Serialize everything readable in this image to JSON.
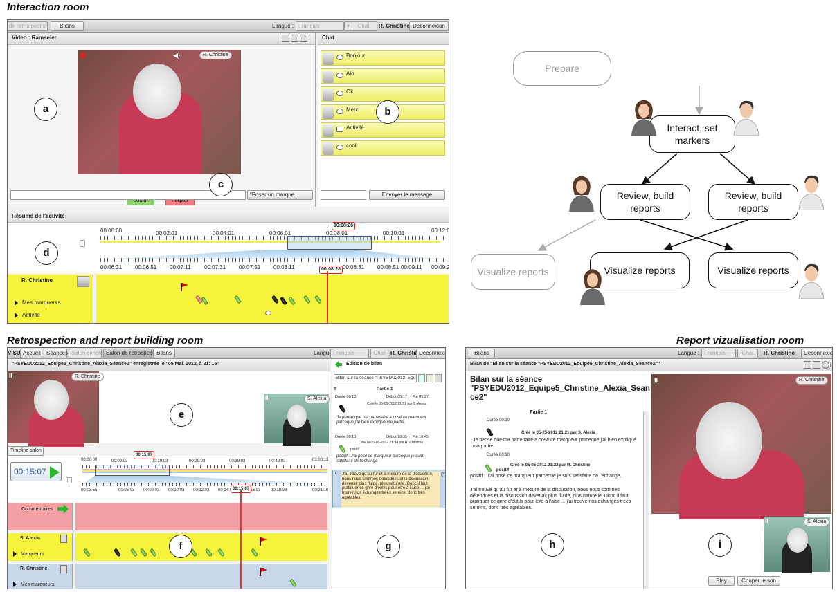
{
  "titles": {
    "interaction": "Interaction room",
    "retrospection": "Retrospection and report building room",
    "report": "Report vizualisation room"
  },
  "labels": {
    "a": "a",
    "b": "b",
    "c": "c",
    "d": "d",
    "e": "e",
    "f": "f",
    "g": "g",
    "h": "h",
    "i": "i"
  },
  "interaction": {
    "tabs": {
      "retro": "de rétrospection",
      "bilans": "Bilans"
    },
    "langue_label": "Langue :",
    "langue_value": "Français",
    "chat_btn": "Chat",
    "user": "R. Christine",
    "logout": "Déconnexion",
    "video_title": "Video : Ramseier",
    "video_badge": "R. Christine",
    "positif": "positif",
    "negatif": "négatif",
    "poser": "\"Poser un marque...",
    "chat_title": "Chat",
    "chat_messages": [
      "Bonjour",
      "Alo",
      "Ok",
      "Merci",
      "Activité",
      "cool"
    ],
    "send": "Envoyer le message",
    "resume": "Résumé de l'activité",
    "top_ticks": [
      "00:00:00",
      "00:02:01",
      "00:04:01",
      "00:06:01",
      "00:08:01",
      "00:10:01",
      "00:12:0"
    ],
    "bottom_ticks": [
      "00:06:31",
      "00:06:51",
      "00:07:11",
      "00:07:31",
      "00:07:51",
      "00:08:11",
      "00:08:31",
      "00:08:51",
      "00:09:11",
      "00:09:2"
    ],
    "time_top": "00:08:28",
    "time_bottom": "00:08:28",
    "lane_user": "R. Christine",
    "lane_mes": "Mes marqueurs",
    "lane_act": "Activité"
  },
  "workflow": {
    "prepare": "Prepare",
    "interact": "Interact, set markers",
    "review1": "Review, build reports",
    "review2": "Review, build reports",
    "vis_grey": "Visualize reports",
    "vis1": "Visualize reports",
    "vis2": "Visualize reports"
  },
  "retro": {
    "tabs": [
      "VISU",
      "Accueil",
      "Séances",
      "Salon synchrone",
      "Salon de rétrospection",
      "Bilans"
    ],
    "langue_label": "Langue",
    "langue_value": "Français",
    "chat_btn": "Chat",
    "user": "R. Christine",
    "logout": "Déconnexion",
    "session": "\"PSYEDU2012_Equipe5_Christine_Alexia_Seance2\" enregistrée le \"05 Mai. 2012, à 21: 15\"",
    "badge_main": "R. Christine",
    "badge_small": "S. Alexia",
    "timeline_tab": "Timeline salon",
    "clock": "00:15:07",
    "top_ticks": [
      "00:00:00",
      "00:09:03",
      "00:19:03",
      "00:29:03",
      "00:39:03",
      "00:49:03",
      "01:00:13"
    ],
    "bottom_ticks": [
      "00:03:55",
      "00:05:03",
      "00:08:03",
      "00:10:03",
      "00:12:03",
      "00:14:03",
      "00:16:03",
      "00:18:03",
      "00:21:10"
    ],
    "time_top": "00:15:07",
    "time_bottom": "00:15:07",
    "lane_comments": "Commentaires",
    "lane_alexia": "S. Alexia",
    "lane_marqueurs": "Marqueurs",
    "lane_christine": "R. Christine",
    "lane_mes": "Mes marqueurs",
    "bilan_title": "Édition de bilan",
    "bilan_select": "Bilan sur la séance \"PSYEDU2012_Equipe5_C",
    "col_t": "T",
    "col_part": "Partie 1",
    "e1_duree": "Durée 00:10",
    "e1_debut": "Début 05:17",
    "e1_fin": "Fin 05:27",
    "e1_cree": "Créé le 05-05-2012 21:21 par S. Alexia",
    "e1_text": "Je pense que ma partenaire a posé ce marqueur parceque j'ai bien expliqué ma partie.",
    "e2_duree": "Durée 00:10",
    "e2_debut": "Début 18:35",
    "e2_fin": "Fin 18:45",
    "e2_cree": "Créé le 05-05-2012 21:34 par R. Christine",
    "e2_pos": "positif",
    "e2_text": "positif : J'ai posé ce marqueur parceque je suid satisfaite de l'échange.",
    "e3_num": "1",
    "e3_text": "J'ai trouvé qu'au fur et à mesure de la discussion, nous nous sommes détendues et la discussion devenait plus fluide, plus naturelle. Donc il faut pratiquer ce gnre d'outils pour être à l'aise ... j'ai trouvé nos échanges treès sereins, donc très agréables."
  },
  "report": {
    "tab": "Bilans",
    "langue_label": "Langue :",
    "langue_value": "Français",
    "chat_btn": "Chat",
    "user": "R. Christine",
    "logout": "Déconnexion",
    "header": "Bilan de \"Bilan sur la séance \"PSYEDU2012_Equipe5_Christine_Alexia_Seance2\"\"",
    "title": "Bilan sur la séance \"PSYEDU2012_Equipe5_Christine_Alexia_Sean ce2\"",
    "part": "Partie 1",
    "d1": "Durée 00:10",
    "c1": "Créé le 05-05-2012 21:21 par S. Alexia",
    "t1": "Je pense que ma partenaire a posé ce marqueur parceque j'ai bien expliqué ma partie.",
    "d2": "Durée 00:10",
    "c2": "Créé le 05-05-2012 21:22 par R. Christine",
    "pos": "positif",
    "t2": "positif : J'ai posé ce marqueur parceque je suis satisfaite de l'échange.",
    "t3": "J'ai trouvé qu'au fur et à mesure de la discussion, nous nous sommes détendues et la discussion devenait plus fluide, plus naturelle. Donc il faut pratiquer ce gnre d'outils pour être à l'aise ... j'ai trouvé nos échanges treès sereins, donc très agréables.",
    "badge_main": "R. Christine",
    "badge_small": "S. Alexia",
    "play": "Play",
    "mute": "Couper le son"
  }
}
